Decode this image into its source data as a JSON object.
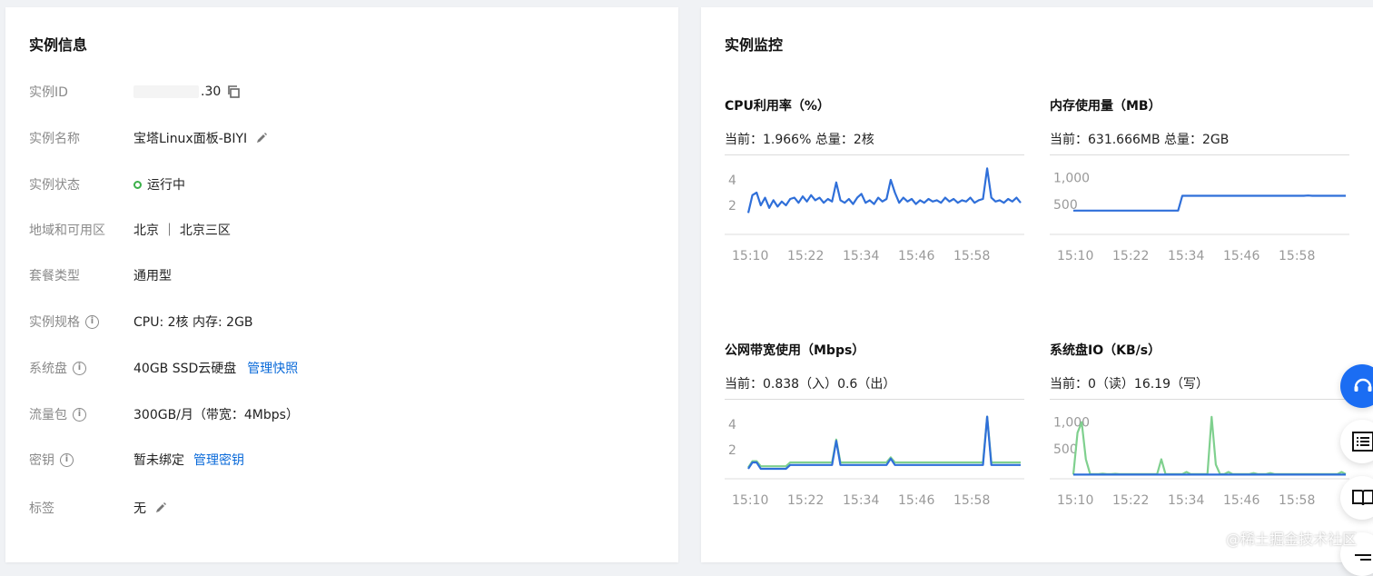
{
  "left_panel": {
    "title": "实例信息",
    "rows": [
      {
        "label": "实例ID",
        "value": ".30"
      },
      {
        "label": "实例名称",
        "value": "宝塔Linux面板-BIYI"
      },
      {
        "label": "实例状态",
        "value": "运行中"
      },
      {
        "label": "地域和可用区",
        "value": "北京 ｜ 北京三区"
      },
      {
        "label": "套餐类型",
        "value": "通用型"
      },
      {
        "label": "实例规格",
        "value": "CPU: 2核 内存: 2GB"
      },
      {
        "label": "系统盘",
        "value": "40GB SSD云硬盘",
        "link": "管理快照"
      },
      {
        "label": "流量包",
        "value": "300GB/月（带宽：4Mbps）"
      },
      {
        "label": "密钥",
        "value": "暂未绑定",
        "link": "管理密钥"
      },
      {
        "label": "标签",
        "value": "无"
      }
    ]
  },
  "right_panel": {
    "title": "实例监控",
    "charts": [
      {
        "title": "CPU利用率（%）",
        "current": "当前：1.966% 总量：2核"
      },
      {
        "title": "内存使用量（MB）",
        "current": "当前：631.666MB 总量：2GB"
      },
      {
        "title": "公网带宽使用（Mbps）",
        "current": "当前：0.838（入）0.6（出）"
      },
      {
        "title": "系统盘IO（KB/s）",
        "current": "当前：0（读）16.19（写）"
      }
    ]
  },
  "colors": {
    "blue": "#2f6fd9",
    "green": "#7fd08e",
    "status": "#3cb04a",
    "link": "#0a6ad9"
  },
  "watermark": "@稀土掘金技术社区",
  "chart_data": [
    {
      "type": "line",
      "x": [
        "15:10",
        "15:22",
        "15:34",
        "15:46",
        "15:58"
      ],
      "ylim": [
        0,
        5
      ],
      "yticks": [
        "2",
        "4"
      ],
      "series": [
        {
          "color": "#2f6fd9",
          "values": [
            1.4,
            2.8,
            3.0,
            2.0,
            2.6,
            1.8,
            2.4,
            1.9,
            2.3,
            2.0,
            2.5,
            2.6,
            2.2,
            2.7,
            2.3,
            2.8,
            2.4,
            2.6,
            2.2,
            2.5,
            2.3,
            3.8,
            2.4,
            2.2,
            2.5,
            2.1,
            2.6,
            2.9,
            2.2,
            2.4,
            2.1,
            2.6,
            2.3,
            2.5,
            4.0,
            3.0,
            2.2,
            2.6,
            2.3,
            2.5,
            2.1,
            2.4,
            2.2,
            2.5,
            2.3,
            2.4,
            2.2,
            2.6,
            2.3,
            2.5,
            2.2,
            2.4,
            2.3,
            2.6,
            2.2,
            2.4,
            2.5,
            4.9,
            2.6,
            2.3,
            2.4,
            2.2,
            2.5,
            2.3,
            2.6,
            2.2
          ]
        }
      ]
    },
    {
      "type": "line",
      "x": [
        "15:10",
        "15:22",
        "15:34",
        "15:46",
        "15:58"
      ],
      "ylim": [
        0,
        1200
      ],
      "yticks": [
        "500",
        "1,000"
      ],
      "series": [
        {
          "color": "#2f6fd9",
          "values": [
            380,
            380,
            380,
            380,
            380,
            380,
            380,
            380,
            380,
            380,
            380,
            380,
            380,
            380,
            380,
            380,
            380,
            380,
            380,
            380,
            380,
            380,
            380,
            380,
            380,
            380,
            660,
            660,
            660,
            660,
            660,
            660,
            660,
            660,
            660,
            660,
            660,
            660,
            660,
            660,
            660,
            660,
            660,
            660,
            660,
            660,
            660,
            660,
            660,
            660,
            660,
            660,
            660,
            660,
            660,
            660,
            665,
            660,
            660,
            660,
            660,
            660,
            660,
            660,
            660,
            660
          ]
        }
      ]
    },
    {
      "type": "line",
      "x": [
        "15:10",
        "15:22",
        "15:34",
        "15:46",
        "15:58"
      ],
      "ylim": [
        0,
        5
      ],
      "yticks": [
        "2",
        "4"
      ],
      "series": [
        {
          "color": "#7fd08e",
          "values": [
            0.6,
            1.1,
            1.1,
            0.7,
            0.7,
            0.7,
            0.7,
            0.7,
            0.7,
            0.7,
            1.0,
            1.0,
            1.0,
            1.0,
            1.0,
            1.0,
            1.0,
            1.0,
            1.0,
            1.0,
            1.0,
            2.8,
            1.0,
            1.0,
            1.0,
            1.0,
            1.0,
            1.0,
            1.0,
            1.0,
            1.0,
            1.0,
            1.0,
            1.0,
            1.4,
            1.0,
            1.0,
            1.0,
            1.0,
            1.0,
            1.0,
            1.0,
            1.0,
            1.0,
            1.0,
            1.0,
            1.0,
            1.0,
            1.0,
            1.0,
            1.0,
            1.0,
            1.0,
            1.0,
            1.0,
            1.0,
            1.0,
            4.6,
            1.0,
            1.0,
            1.0,
            1.0,
            1.0,
            1.0,
            1.0,
            1.0
          ]
        },
        {
          "color": "#2f6fd9",
          "values": [
            0.5,
            1.0,
            1.0,
            0.5,
            0.5,
            0.5,
            0.5,
            0.5,
            0.5,
            0.5,
            0.8,
            0.8,
            0.8,
            0.8,
            0.8,
            0.8,
            0.8,
            0.8,
            0.8,
            0.8,
            0.8,
            2.7,
            0.8,
            0.8,
            0.8,
            0.8,
            0.8,
            0.8,
            0.8,
            0.8,
            0.8,
            0.8,
            0.8,
            0.8,
            1.3,
            0.8,
            0.8,
            0.8,
            0.8,
            0.8,
            0.8,
            0.8,
            0.8,
            0.8,
            0.8,
            0.8,
            0.8,
            0.8,
            0.8,
            0.8,
            0.8,
            0.8,
            0.8,
            0.8,
            0.8,
            0.8,
            0.8,
            4.6,
            0.8,
            0.8,
            0.8,
            0.8,
            0.8,
            0.8,
            0.8,
            0.8
          ]
        }
      ]
    },
    {
      "type": "line",
      "x": [
        "15:10",
        "15:22",
        "15:34",
        "15:46",
        "15:58"
      ],
      "ylim": [
        0,
        1200
      ],
      "yticks": [
        "500",
        "1,000"
      ],
      "series": [
        {
          "color": "#7fd08e",
          "values": [
            10,
            800,
            1000,
            300,
            20,
            20,
            20,
            30,
            20,
            20,
            25,
            20,
            20,
            20,
            20,
            20,
            20,
            20,
            20,
            20,
            20,
            300,
            20,
            20,
            20,
            20,
            20,
            60,
            20,
            20,
            20,
            20,
            20,
            1100,
            200,
            20,
            20,
            60,
            20,
            20,
            20,
            20,
            20,
            40,
            20,
            20,
            20,
            40,
            20,
            20,
            20,
            20,
            20,
            20,
            20,
            20,
            20,
            20,
            20,
            20,
            20,
            20,
            20,
            20,
            60,
            20
          ]
        },
        {
          "color": "#2f6fd9",
          "values": [
            10,
            10,
            10,
            10,
            10,
            10,
            10,
            10,
            10,
            10,
            10,
            10,
            10,
            10,
            10,
            10,
            10,
            10,
            10,
            10,
            10,
            10,
            10,
            10,
            10,
            10,
            10,
            10,
            10,
            10,
            10,
            10,
            10,
            10,
            10,
            10,
            10,
            10,
            10,
            10,
            10,
            10,
            10,
            10,
            10,
            10,
            10,
            10,
            10,
            10,
            10,
            10,
            10,
            10,
            10,
            10,
            10,
            10,
            10,
            10,
            10,
            10,
            10,
            10,
            10,
            10
          ]
        }
      ]
    }
  ]
}
